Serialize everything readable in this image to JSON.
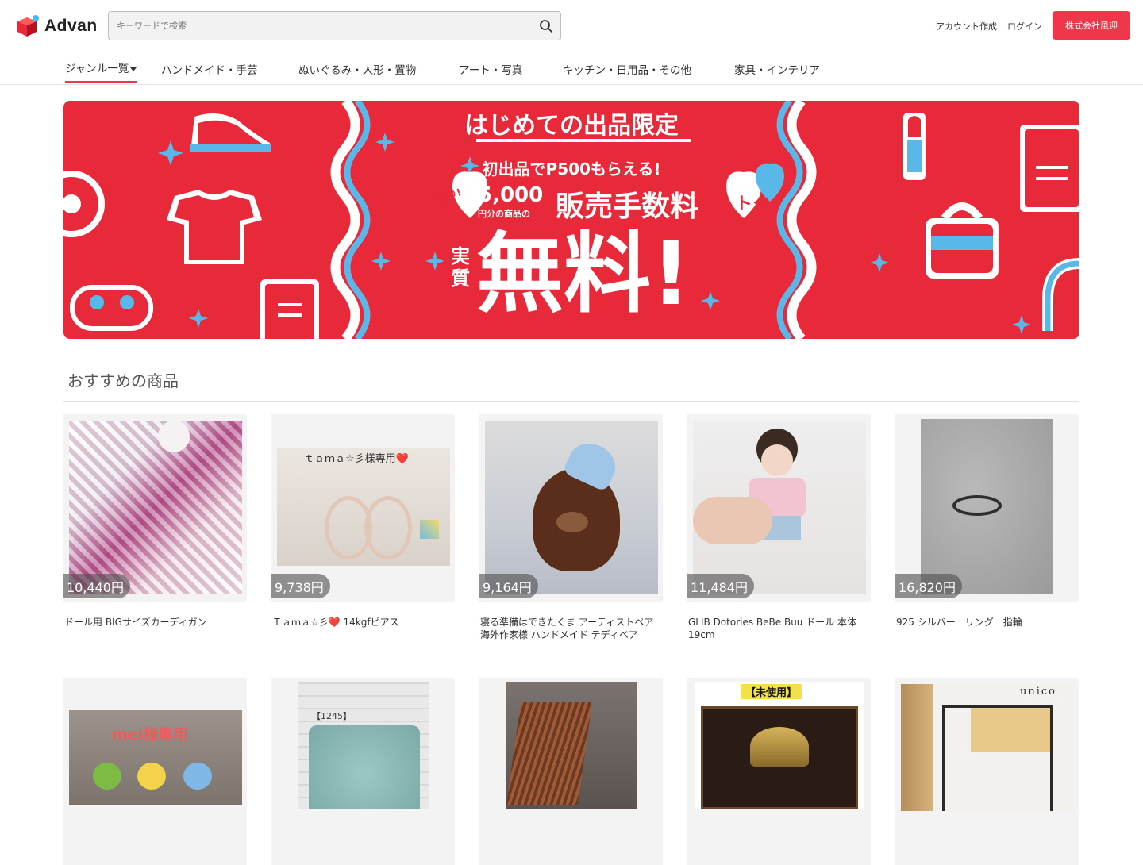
{
  "header": {
    "logo_text": "Advan",
    "search_placeholder": "キーワードで検索",
    "create_account": "アカウント作成",
    "login": "ログイン",
    "company": "株式会社風迎"
  },
  "nav": {
    "items": [
      {
        "label": "ジャンル一覧"
      },
      {
        "label": "ハンドメイド・手芸"
      },
      {
        "label": "ぬいぐるみ・人形・置物"
      },
      {
        "label": "アート・写真"
      },
      {
        "label": "キッチン・日用品・その他"
      },
      {
        "label": "家具・インテリア"
      }
    ]
  },
  "banner": {
    "headline": "はじめての出品限定",
    "sub": "初出品でP500もらえる!",
    "tsumari": "つまり!",
    "amount": "5,000",
    "amount_note": "円分の商品の",
    "fee": "販売手数料",
    "jisshitsu": "実質",
    "free": "無料!",
    "toku": "トク",
    "colors": {
      "red": "#e8293a",
      "blue": "#5ab8e8",
      "white": "#ffffff"
    }
  },
  "section": {
    "title": "おすすめの商品"
  },
  "products": [
    {
      "price": "10,440円",
      "name": "ドール用 BIGサイズカーディガン",
      "icon": "cardigan-photo"
    },
    {
      "price": "9,738円",
      "name": "Ｔａｍａ☆彡❤️ 14kgfピアス",
      "icon": "earrings-photo",
      "overlay": "ｔａｍａ☆彡様専用❤️"
    },
    {
      "price": "9,164円",
      "name": "寝る準備はできたくま アーティストベア 海外作家様 ハンドメイド テディベア",
      "icon": "teddy-bear-photo"
    },
    {
      "price": "11,484円",
      "name": "GLIB Dotories BeBe Buu ドール 本体 19cm",
      "icon": "doll-photo"
    },
    {
      "price": "16,820円",
      "name": "925 シルバー　リング　指輪",
      "icon": "ring-photo"
    },
    {
      "price": "",
      "name": "",
      "icon": "crochet-birds-photo",
      "overlay": "mei様専用"
    },
    {
      "price": "",
      "name": "",
      "icon": "cushion-photo",
      "overlay": "【1245】"
    },
    {
      "price": "",
      "name": "",
      "icon": "chair-photo"
    },
    {
      "price": "",
      "name": "",
      "icon": "kabuto-photo",
      "overlay": "【未使用】"
    },
    {
      "price": "",
      "name": "",
      "icon": "shelf-photo",
      "overlay": "unico"
    }
  ]
}
